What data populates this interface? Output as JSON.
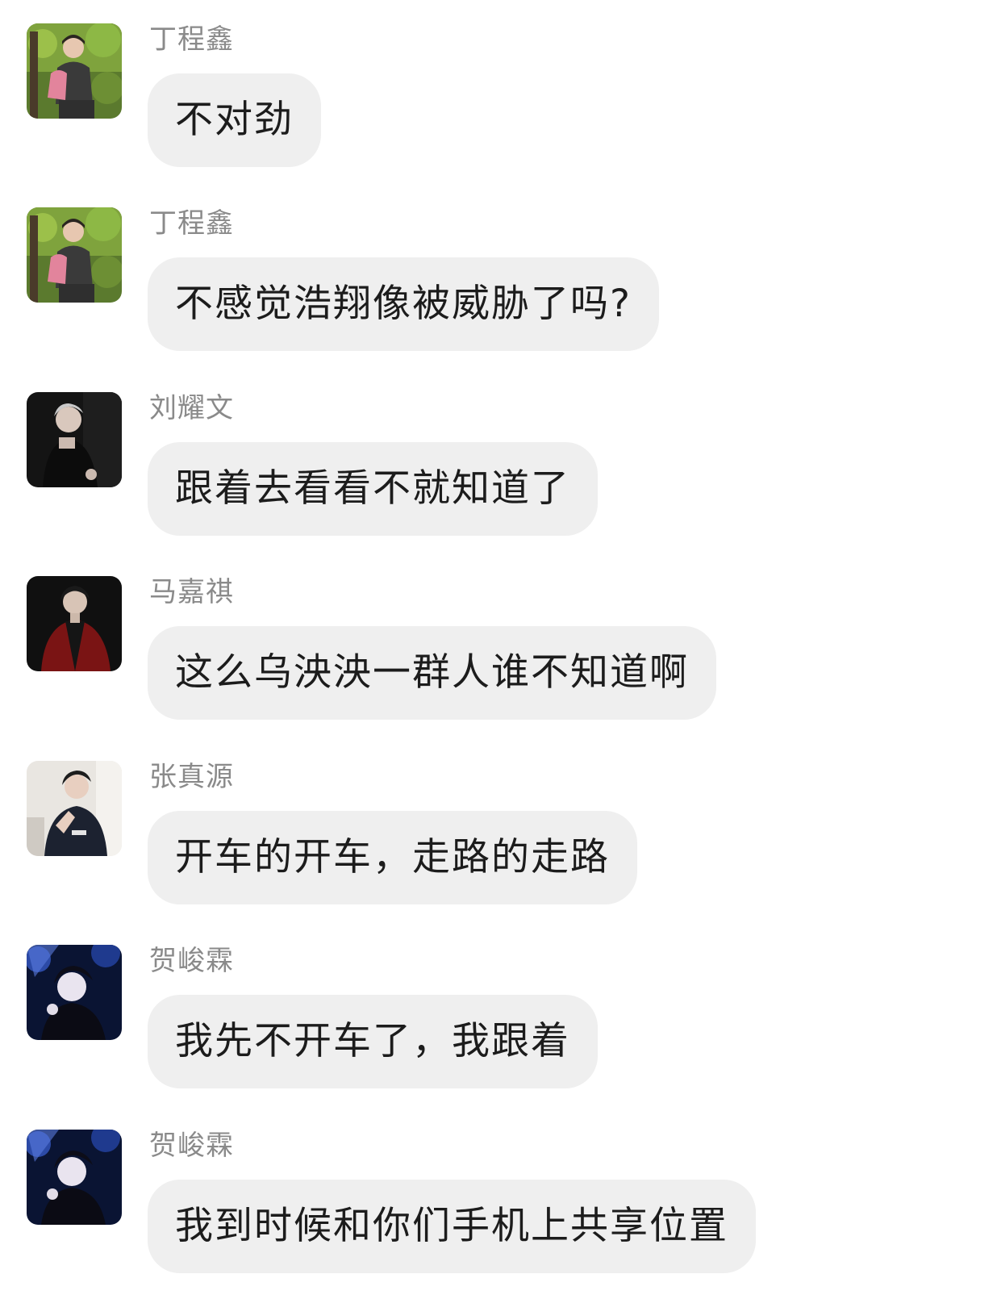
{
  "messages": [
    {
      "sender": "丁程鑫",
      "text": "不对劲",
      "avatar": "avatar-forest"
    },
    {
      "sender": "丁程鑫",
      "text": "不感觉浩翔像被威胁了吗?",
      "avatar": "avatar-forest"
    },
    {
      "sender": "刘耀文",
      "text": "跟着去看看不就知道了",
      "avatar": "avatar-dark-portrait"
    },
    {
      "sender": "马嘉祺",
      "text": "这么乌泱泱一群人谁不知道啊",
      "avatar": "avatar-red-jacket"
    },
    {
      "sender": "张真源",
      "text": "开车的开车，走路的走路",
      "avatar": "avatar-light-portrait"
    },
    {
      "sender": "贺峻霖",
      "text": "我先不开车了，我跟着",
      "avatar": "avatar-blue-night"
    },
    {
      "sender": "贺峻霖",
      "text": "我到时候和你们手机上共享位置",
      "avatar": "avatar-blue-night"
    }
  ],
  "colors": {
    "background": "#ffffff",
    "bubble": "#efefef",
    "sender_text": "#8a8a8a",
    "message_text": "#1c1c1c"
  }
}
